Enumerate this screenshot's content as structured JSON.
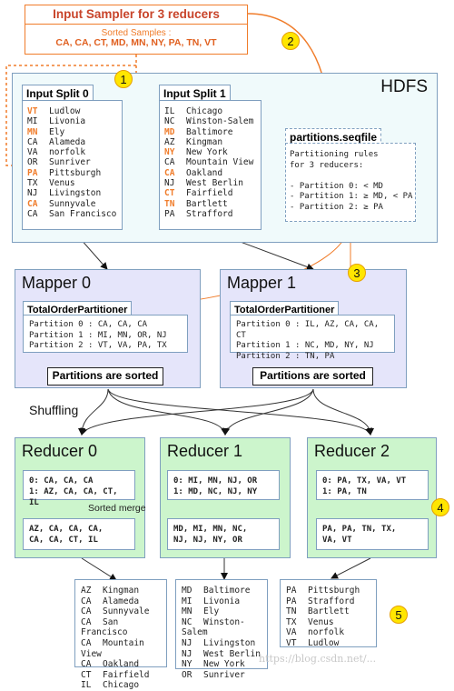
{
  "sampler": {
    "title": "Input Sampler for 3 reducers",
    "subtitle": "Sorted Samples :",
    "samples": "CA, CA, CT, MD, MN, NY, PA, TN, VT"
  },
  "hdfs": {
    "label": "HDFS",
    "splits": [
      {
        "title": "Input Split 0",
        "rows": [
          {
            "key": "VT",
            "city": "Ludlow",
            "highlight": true
          },
          {
            "key": "MI",
            "city": "Livonia",
            "highlight": false
          },
          {
            "key": "MN",
            "city": "Ely",
            "highlight": true
          },
          {
            "key": "CA",
            "city": "Alameda",
            "highlight": false
          },
          {
            "key": "VA",
            "city": "norfolk",
            "highlight": false
          },
          {
            "key": "OR",
            "city": "Sunriver",
            "highlight": false
          },
          {
            "key": "PA",
            "city": "Pittsburgh",
            "highlight": true
          },
          {
            "key": "TX",
            "city": "Venus",
            "highlight": false
          },
          {
            "key": "NJ",
            "city": "Livingston",
            "highlight": false
          },
          {
            "key": "CA",
            "city": "Sunnyvale",
            "highlight": true
          },
          {
            "key": "CA",
            "city": "San Francisco",
            "highlight": false
          }
        ]
      },
      {
        "title": "Input Split 1",
        "rows": [
          {
            "key": "IL",
            "city": "Chicago",
            "highlight": false
          },
          {
            "key": "NC",
            "city": "Winston-Salem",
            "highlight": false
          },
          {
            "key": "MD",
            "city": "Baltimore",
            "highlight": true
          },
          {
            "key": "AZ",
            "city": "Kingman",
            "highlight": false
          },
          {
            "key": "NY",
            "city": "New York",
            "highlight": true
          },
          {
            "key": "CA",
            "city": "Mountain View",
            "highlight": false
          },
          {
            "key": "CA",
            "city": "Oakland",
            "highlight": true
          },
          {
            "key": "NJ",
            "city": "West Berlin",
            "highlight": false
          },
          {
            "key": "CT",
            "city": "Fairfield",
            "highlight": true
          },
          {
            "key": "TN",
            "city": "Bartlett",
            "highlight": true
          },
          {
            "key": "PA",
            "city": "Strafford",
            "highlight": false
          }
        ]
      }
    ],
    "partitions_file": {
      "title": "partitions.seqfile",
      "lines": [
        "Partitioning rules",
        "for 3 reducers:",
        "",
        "- Partition 0: < MD",
        "- Partition 1: ≥ MD, < PA",
        "- Partition 2: ≥ PA"
      ]
    }
  },
  "mappers": [
    {
      "title": "Mapper 0",
      "partitioner": "TotalOrderPartitioner",
      "partitions": [
        "Partition 0 : CA, CA, CA",
        "Partition 1 : MI, MN, OR, NJ",
        "Partition 2 : VT, VA, PA, TX"
      ],
      "sorted_label": "Partitions are sorted"
    },
    {
      "title": "Mapper 1",
      "partitioner": "TotalOrderPartitioner",
      "partitions": [
        "Partition 0 : IL, AZ, CA, CA, CT",
        "Partition 1 : NC, MD, NY, NJ",
        "Partition 2 : TN, PA"
      ],
      "sorted_label": "Partitions are sorted"
    }
  ],
  "shuffle_label": "Shuffling",
  "sorted_merge_label": "Sorted merge",
  "reducers": [
    {
      "title": "Reducer 0",
      "inputs": [
        "0: CA, CA, CA",
        "1: AZ, CA, CA, CT, IL"
      ],
      "merged": [
        "AZ, CA, CA, CA,",
        "CA, CA, CT, IL"
      ],
      "output": [
        {
          "key": "AZ",
          "city": "Kingman"
        },
        {
          "key": "CA",
          "city": "Alameda"
        },
        {
          "key": "CA",
          "city": "Sunnyvale"
        },
        {
          "key": "CA",
          "city": "San Francisco"
        },
        {
          "key": "CA",
          "city": "Mountain View"
        },
        {
          "key": "CA",
          "city": "Oakland"
        },
        {
          "key": "CT",
          "city": "Fairfield"
        },
        {
          "key": "IL",
          "city": "Chicago"
        }
      ]
    },
    {
      "title": "Reducer 1",
      "inputs": [
        "0: MI, MN, NJ, OR",
        "1: MD, NC, NJ, NY"
      ],
      "merged": [
        "MD, MI, MN, NC,",
        "NJ, NJ, NY, OR"
      ],
      "output": [
        {
          "key": "MD",
          "city": "Baltimore"
        },
        {
          "key": "MI",
          "city": "Livonia"
        },
        {
          "key": "MN",
          "city": "Ely"
        },
        {
          "key": "NC",
          "city": "Winston-Salem"
        },
        {
          "key": "NJ",
          "city": "Livingston"
        },
        {
          "key": "NJ",
          "city": "West Berlin"
        },
        {
          "key": "NY",
          "city": "New York"
        },
        {
          "key": "OR",
          "city": "Sunriver"
        }
      ]
    },
    {
      "title": "Reducer 2",
      "inputs": [
        "0: PA, TX, VA, VT",
        "1: PA, TN"
      ],
      "merged": [
        "PA, PA, TN, TX,",
        "VA, VT"
      ],
      "output": [
        {
          "key": "PA",
          "city": "Pittsburgh"
        },
        {
          "key": "PA",
          "city": "Strafford"
        },
        {
          "key": "TN",
          "city": "Bartlett"
        },
        {
          "key": "TX",
          "city": "Venus"
        },
        {
          "key": "VA",
          "city": "norfolk"
        },
        {
          "key": "VT",
          "city": "Ludlow"
        }
      ]
    }
  ],
  "badges": [
    "1",
    "2",
    "3",
    "4",
    "5"
  ],
  "watermark": "https://blog.csdn.net/...",
  "colors": {
    "orange": "#f07c2a",
    "sampler_title": "#c8442a",
    "hdfs_bg": "#f0fafb",
    "mapper_bg": "#e5e5fa",
    "reducer_bg": "#ccf5cc",
    "border": "#7f9fbf",
    "badge": "#ffe600"
  }
}
